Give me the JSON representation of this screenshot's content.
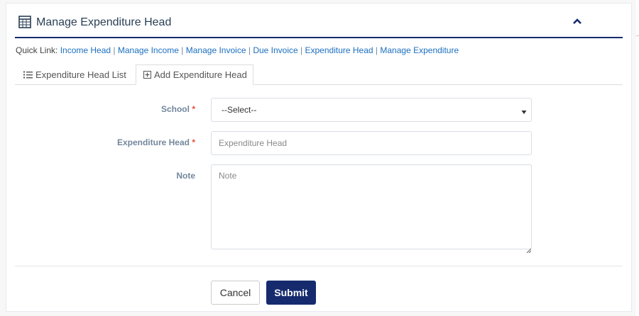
{
  "panel": {
    "title": "Manage Expenditure Head",
    "title_icon": "table-icon",
    "collapse_icon": "chevron-up-icon"
  },
  "quick_links": {
    "label": "Quick Link:",
    "links": [
      "Income Head",
      "Manage Income",
      "Manage Invoice",
      "Due Invoice",
      "Expenditure Head",
      "Manage Expenditure"
    ],
    "separator": "|"
  },
  "tabs": [
    {
      "label": "Expenditure Head List",
      "icon": "list-icon",
      "active": false
    },
    {
      "label": "Add Expenditure Head",
      "icon": "plus-square-icon",
      "active": true
    }
  ],
  "form": {
    "school": {
      "label": "School",
      "required_mark": "*",
      "value": "--Select--"
    },
    "expenditure_head": {
      "label": "Expenditure Head",
      "required_mark": "*",
      "value": "",
      "placeholder": "Expenditure Head"
    },
    "note": {
      "label": "Note",
      "value": "",
      "placeholder": "Note"
    }
  },
  "buttons": {
    "cancel": "Cancel",
    "submit": "Submit"
  },
  "colors": {
    "brand": "#162b6e",
    "link": "#1c6fbf",
    "required": "#e74c3c",
    "label": "#73879c"
  }
}
